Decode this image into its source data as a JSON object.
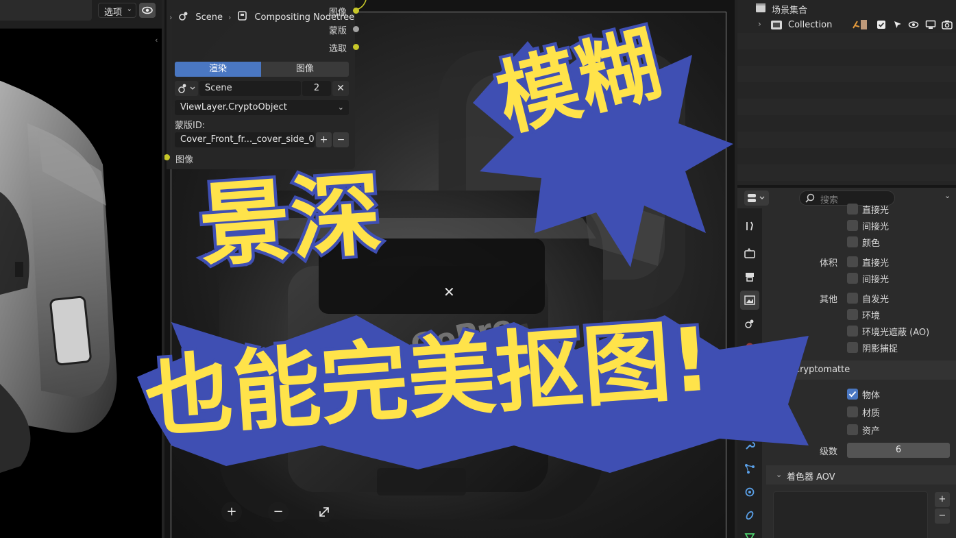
{
  "left_header": {
    "options_label": "选项"
  },
  "node_editor": {
    "breadcrumb": {
      "scene": "Scene",
      "tree": "Compositing Nodetree"
    },
    "outputs": {
      "image": "图像",
      "matte": "蒙版",
      "pick": "选取"
    },
    "tabs": {
      "render": "渲染",
      "image": "图像"
    },
    "scene_field": {
      "value": "Scene",
      "users": "2"
    },
    "layer_select": "ViewLayer.CryptoObject",
    "matte_id_label": "蒙版ID:",
    "matte_id_value": "Cover_Front_fr..._cover_side_0",
    "image_input_label": "图像",
    "socket_colors": {
      "image": "#c7c729",
      "matte": "#a3a3a3",
      "pick": "#c7c729"
    }
  },
  "outliner": {
    "scene_collection": "场景集合",
    "collection": "Collection"
  },
  "properties": {
    "search_placeholder": "搜索",
    "groups": [
      {
        "group": "",
        "items": [
          {
            "label": "直接光",
            "checked": false
          },
          {
            "label": "间接光",
            "checked": false
          },
          {
            "label": "颜色",
            "checked": false
          }
        ]
      },
      {
        "group": "体积",
        "items": [
          {
            "label": "直接光",
            "checked": false
          },
          {
            "label": "间接光",
            "checked": false
          }
        ]
      },
      {
        "group": "其他",
        "items": [
          {
            "label": "自发光",
            "checked": false
          },
          {
            "label": "环境",
            "checked": false
          },
          {
            "label": "环境光遮蔽 (AO)",
            "checked": false
          },
          {
            "label": "阴影捕捉",
            "checked": false
          }
        ]
      }
    ],
    "cryptomatte": {
      "title": "Cryptomatte",
      "items": [
        {
          "label": "物体",
          "checked": true
        },
        {
          "label": "材质",
          "checked": false
        },
        {
          "label": "资产",
          "checked": false
        }
      ],
      "levels_label": "级数",
      "levels_value": "6"
    },
    "aov": {
      "title": "着色器 AOV"
    }
  },
  "overlay": {
    "line1": "模糊",
    "line2": "景深",
    "line3": "也能完美抠图!",
    "fill_color": "#ffe34a",
    "stroke_color": "#3f4fb3"
  },
  "render_preview": {
    "brand": "GoPro"
  }
}
